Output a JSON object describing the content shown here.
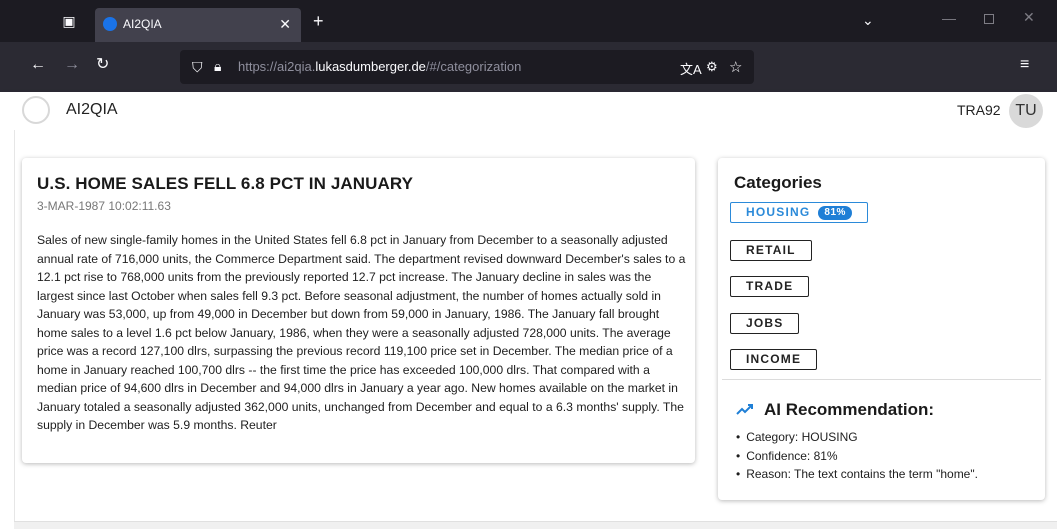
{
  "browser": {
    "tab_title": "AI2QIA",
    "url_prefix": "https://ai2qia.",
    "url_host": "lukasdumberger.de",
    "url_suffix": "/#/categorization",
    "icons": [
      "tab-list-icon",
      "close-icon",
      "plus-icon",
      "chevron-down-icon",
      "minimize-icon",
      "maximize-icon",
      "close-window-icon",
      "back-arrow-icon",
      "forward-arrow-icon",
      "reload-icon",
      "shield-icon",
      "lock-icon",
      "translate-icon",
      "extension-icon",
      "star-icon",
      "hamburger-menu-icon"
    ]
  },
  "app": {
    "title": "AI2QIA",
    "user_code": "TRA92",
    "avatar_initials": "TU"
  },
  "article": {
    "title": "U.S. HOME SALES FELL 6.8 PCT IN JANUARY",
    "date": "3-MAR-1987 10:02:11.63",
    "body": "Sales of new single-family homes in the United States fell 6.8 pct in January from December to a seasonally adjusted annual rate of 716,000 units, the Commerce Department said. The department revised downward December's sales to a 12.1 pct rise to 768,000 units from the previously reported 12.7 pct increase. The January decline in sales was the largest since last October when sales fell 9.3 pct. Before seasonal adjustment, the number of homes actually sold in January was 53,000, up from 49,000 in December but down from 59,000 in January, 1986. The January fall brought home sales to a level 1.6 pct below January, 1986, when they were a seasonally adjusted 728,000 units. The average price was a record 127,100 dlrs, surpassing the previous record 119,100 price set in December. The median price of a home in January reached 100,700 dlrs -- the first time the price has exceeded 100,000 dlrs. That compared with a median price of 94,600 dlrs in December and 94,000 dlrs in January a year ago. New homes available on the market in January totaled a seasonally adjusted 362,000 units, unchanged from December and equal to a 6.3 months' supply. The supply in December was 5.9 months. Reuter"
  },
  "categories": {
    "heading": "Categories",
    "selected_color": "#1f7fd6",
    "items": [
      {
        "label": "HOUSING",
        "badge": "81%",
        "selected": true
      },
      {
        "label": "RETAIL"
      },
      {
        "label": "TRADE"
      },
      {
        "label": "JOBS"
      },
      {
        "label": "INCOME"
      }
    ]
  },
  "recommendation": {
    "icon": "trending-up-icon",
    "heading": "AI Recommendation:",
    "items": [
      "Category: HOUSING",
      "Confidence: 81%",
      "Reason: The text contains the term \"home\"."
    ]
  }
}
